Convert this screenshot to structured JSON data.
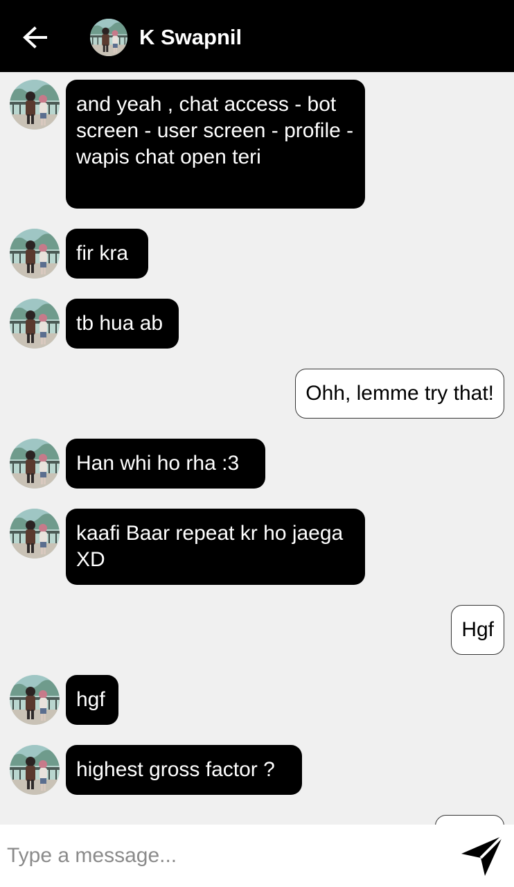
{
  "header": {
    "title": "K Swapnil",
    "back_icon": "arrow-left-icon"
  },
  "messages": [
    {
      "direction": "incoming",
      "text": "and yeah , chat access - bot screen - user screen - profile - wapis chat open teri"
    },
    {
      "direction": "incoming",
      "text": "fir kra"
    },
    {
      "direction": "incoming",
      "text": "tb hua ab"
    },
    {
      "direction": "outgoing",
      "text": "Ohh, lemme try that!"
    },
    {
      "direction": "incoming",
      "text": "Han whi ho rha :3"
    },
    {
      "direction": "incoming",
      "text": "kaafi Baar repeat kr ho jaega XD"
    },
    {
      "direction": "outgoing",
      "text": "Hgf"
    },
    {
      "direction": "incoming",
      "text": "hgf"
    },
    {
      "direction": "incoming",
      "text": "highest gross factor ?"
    }
  ],
  "composer": {
    "placeholder": "Type a message...",
    "value": "",
    "send_icon": "send-icon"
  },
  "colors": {
    "header_bg": "#000000",
    "chat_bg": "#f0f0f0",
    "incoming_bubble": "#000000",
    "outgoing_bubble": "#ffffff"
  }
}
